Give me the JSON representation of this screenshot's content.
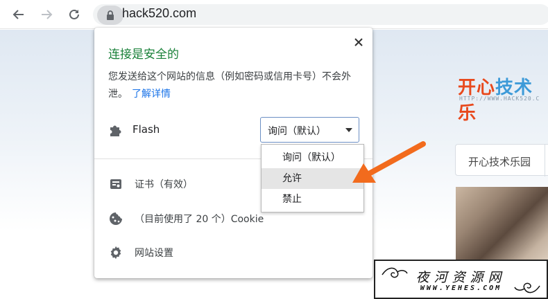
{
  "toolbar": {
    "back_icon": "back-arrow-icon",
    "forward_icon": "forward-arrow-icon",
    "reload_icon": "reload-icon",
    "lock_icon": "lock-icon",
    "url": "hack520.com"
  },
  "page": {
    "logo_part1": "开心",
    "logo_part2": "技术",
    "logo_part3": "乐",
    "logo_sub": "HTTP://WWW.HACK520.C",
    "nav_label": "开心技术乐园"
  },
  "popup": {
    "title": "连接是安全的",
    "description": "您发送给这个网站的信息（例如密码或信用卡号）不会外泄。",
    "learn_more": "了解详情",
    "permission": {
      "label": "Flash",
      "icon": "puzzle-icon",
      "selected": "询问（默认）",
      "options": [
        "询问（默认）",
        "允许",
        "禁止"
      ],
      "highlighted_index": 1
    },
    "certificate": "证书（有效）",
    "cookies": "（目前使用了 20 个）Cookie",
    "site_settings": "网站设置"
  },
  "watermark": {
    "title": "夜河资源网",
    "url": "WWW.YEHES.COM"
  },
  "colors": {
    "title_green": "#188038",
    "link_blue": "#1a73e8",
    "annotation_arrow": "#f26b1d"
  }
}
